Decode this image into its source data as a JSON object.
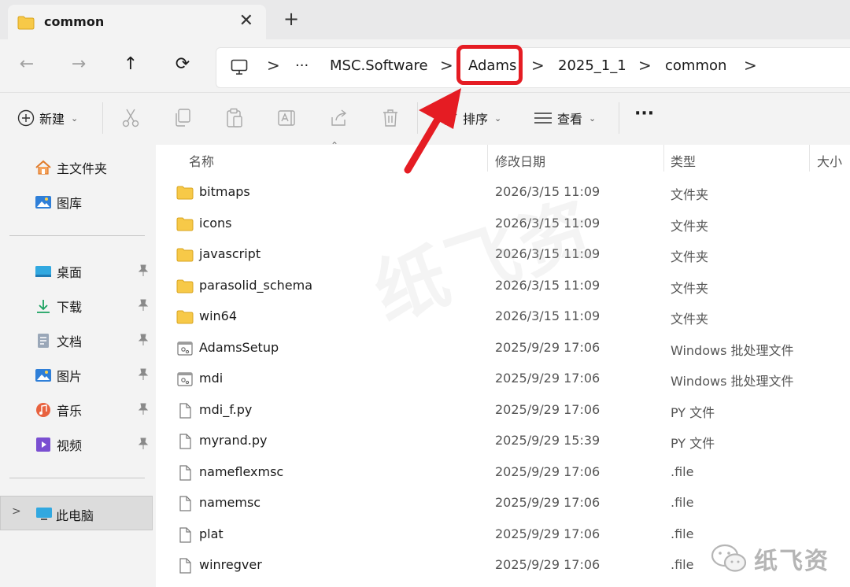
{
  "tab": {
    "title": "common",
    "close": "✕",
    "new_tab": "+"
  },
  "nav": {
    "back": "←",
    "forward": "→",
    "up": "↑",
    "refresh": "⟳"
  },
  "breadcrumb": {
    "overflow": "···",
    "items": [
      "MSC.Software",
      "Adams",
      "2025_1_1",
      "common"
    ],
    "separator": ">"
  },
  "toolbar": {
    "new_label": "新建",
    "sort_label": "排序",
    "view_label": "查看",
    "more_label": "···"
  },
  "sidebar": {
    "top": [
      {
        "label": "主文件夹",
        "icon": "home-icon"
      },
      {
        "label": "图库",
        "icon": "gallery-icon"
      }
    ],
    "quick": [
      {
        "label": "桌面",
        "icon": "desktop-icon"
      },
      {
        "label": "下载",
        "icon": "download-icon"
      },
      {
        "label": "文档",
        "icon": "document-icon"
      },
      {
        "label": "图片",
        "icon": "pictures-icon"
      },
      {
        "label": "音乐",
        "icon": "music-icon"
      },
      {
        "label": "视频",
        "icon": "video-icon"
      }
    ],
    "this_pc": "此电脑"
  },
  "columns": {
    "name": "名称",
    "date": "修改日期",
    "type": "类型",
    "size": "大小"
  },
  "files": [
    {
      "name": "bitmaps",
      "date": "2026/3/15 11:09",
      "type": "文件夹",
      "kind": "folder"
    },
    {
      "name": "icons",
      "date": "2026/3/15 11:09",
      "type": "文件夹",
      "kind": "folder"
    },
    {
      "name": "javascript",
      "date": "2026/3/15 11:09",
      "type": "文件夹",
      "kind": "folder"
    },
    {
      "name": "parasolid_schema",
      "date": "2026/3/15 11:09",
      "type": "文件夹",
      "kind": "folder"
    },
    {
      "name": "win64",
      "date": "2026/3/15 11:09",
      "type": "文件夹",
      "kind": "folder"
    },
    {
      "name": "AdamsSetup",
      "date": "2025/9/29 17:06",
      "type": "Windows 批处理文件",
      "kind": "batch"
    },
    {
      "name": "mdi",
      "date": "2025/9/29 17:06",
      "type": "Windows 批处理文件",
      "kind": "batch"
    },
    {
      "name": "mdi_f.py",
      "date": "2025/9/29 17:06",
      "type": "PY 文件",
      "kind": "file"
    },
    {
      "name": "myrand.py",
      "date": "2025/9/29 15:39",
      "type": "PY 文件",
      "kind": "file"
    },
    {
      "name": "nameflexmsc",
      "date": "2025/9/29 17:06",
      "type": ".file",
      "kind": "file"
    },
    {
      "name": "namemsc",
      "date": "2025/9/29 17:06",
      "type": ".file",
      "kind": "file"
    },
    {
      "name": "plat",
      "date": "2025/9/29 17:06",
      "type": ".file",
      "kind": "file"
    },
    {
      "name": "winregver",
      "date": "2025/9/29 17:06",
      "type": ".file",
      "kind": "file"
    }
  ],
  "watermark": {
    "text": "纸飞资"
  },
  "colors": {
    "highlight": "#e51c23",
    "folder": "#f7c948",
    "accent": "#0067c0"
  }
}
